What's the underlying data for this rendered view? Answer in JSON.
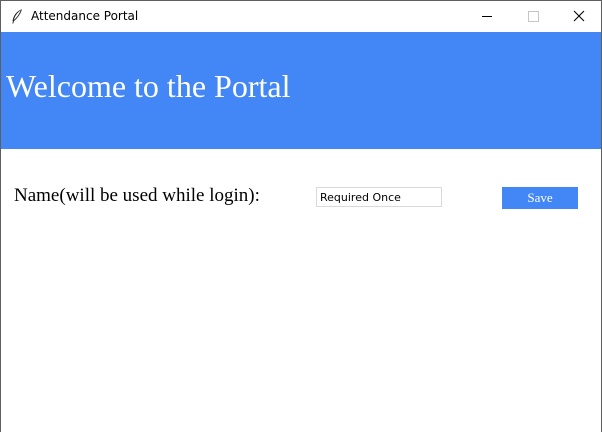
{
  "window": {
    "title": "Attendance Portal",
    "controls": {
      "minimize_icon": "minimize-icon",
      "maximize_icon": "maximize-icon",
      "close_icon": "close-icon"
    }
  },
  "header": {
    "title": "Welcome to the Portal",
    "background": "#4287f5"
  },
  "form": {
    "name_label": "Name(will be used while login):",
    "name_value": "Required Once",
    "save_label": "Save",
    "save_background": "#4287f5"
  }
}
